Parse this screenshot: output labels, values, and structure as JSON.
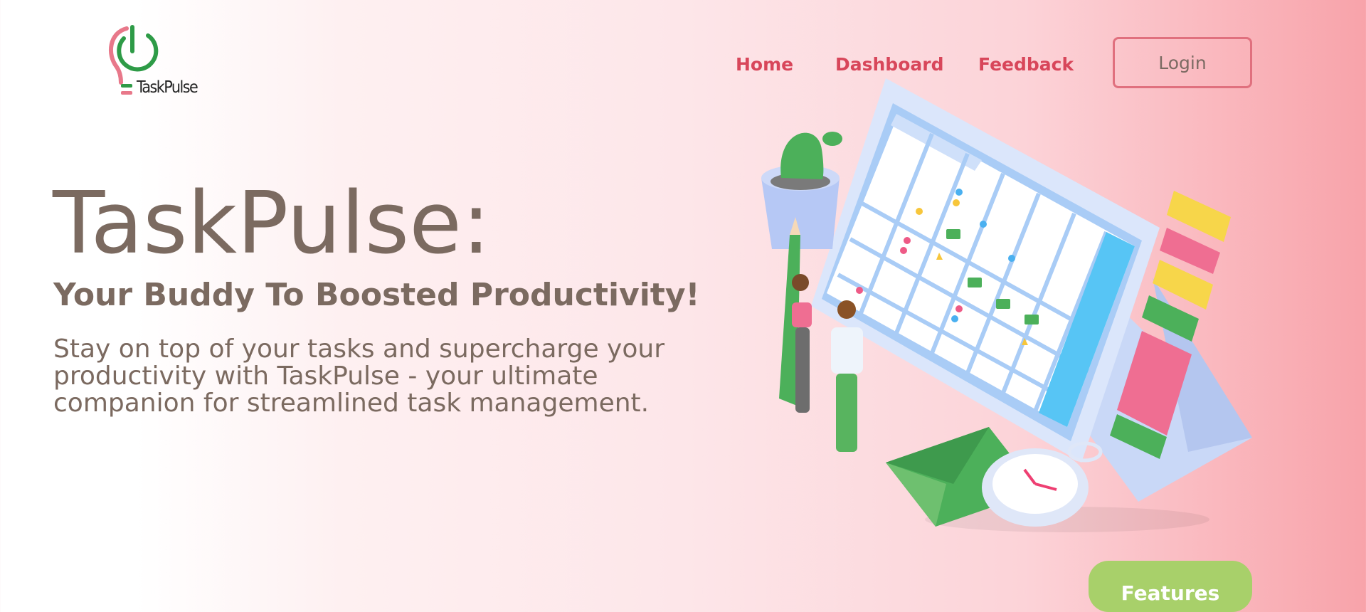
{
  "brand": {
    "name": "TaskPulse"
  },
  "nav": {
    "home": "Home",
    "dashboard": "Dashboard",
    "feedback": "Feedback",
    "login": "Login"
  },
  "hero": {
    "title": "TaskPulse:",
    "subtitle": "Your Buddy To Boosted Productivity!",
    "description": "Stay on top of your tasks and supercharge your productivity with TaskPulse - your ultimate companion for streamlined task management."
  },
  "features_button": "Features",
  "colors": {
    "accent_red": "#d8465a",
    "text_brown": "#7b6a60",
    "green": "#a8d06a",
    "logo_pink": "#e8788a",
    "logo_green": "#2e9b47"
  },
  "icons": {
    "logo": "power-bulb-icon",
    "illustration": "calendar-planner-illustration"
  }
}
